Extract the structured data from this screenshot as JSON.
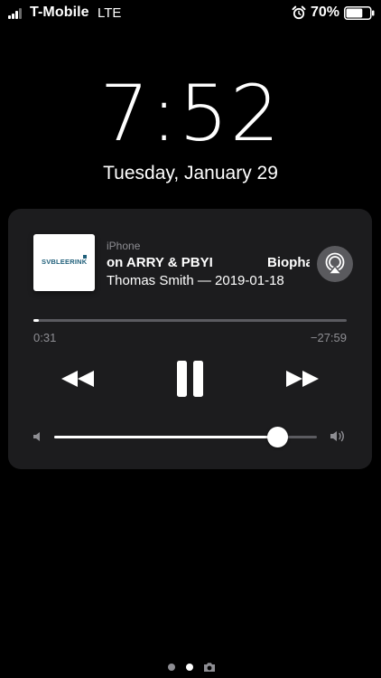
{
  "status_bar": {
    "carrier": "T-Mobile",
    "network": "LTE",
    "battery_percent": "70%",
    "battery_level": 0.7,
    "signal_bars_active": 3,
    "signal_bars_total": 4,
    "icons": [
      "signal-icon",
      "alarm-icon",
      "battery-icon"
    ]
  },
  "lock_screen": {
    "time": "7:52",
    "date": "Tuesday, January 29"
  },
  "now_playing": {
    "source": "iPhone",
    "title": "on ARRY & PBYI",
    "title_next": "Biopha",
    "subtitle": "Thomas Smith — 2019-01-18",
    "artwork_label": "SVBLEERINK",
    "elapsed": "0:31",
    "remaining": "−27:59",
    "progress": 0.018,
    "volume": 0.85,
    "controls": {
      "rewind": "rewind-icon",
      "pause": "pause-icon",
      "forward": "fast-forward-icon",
      "airplay": "airplay-icon"
    }
  },
  "page_indicator": {
    "pages": 2,
    "current": 2,
    "extra": "camera-icon"
  },
  "colors": {
    "background": "#000000",
    "widget": "#1c1c1e",
    "secondary_text": "#8e8e93",
    "track": "#5b5b60",
    "accent": "#ffffff"
  }
}
